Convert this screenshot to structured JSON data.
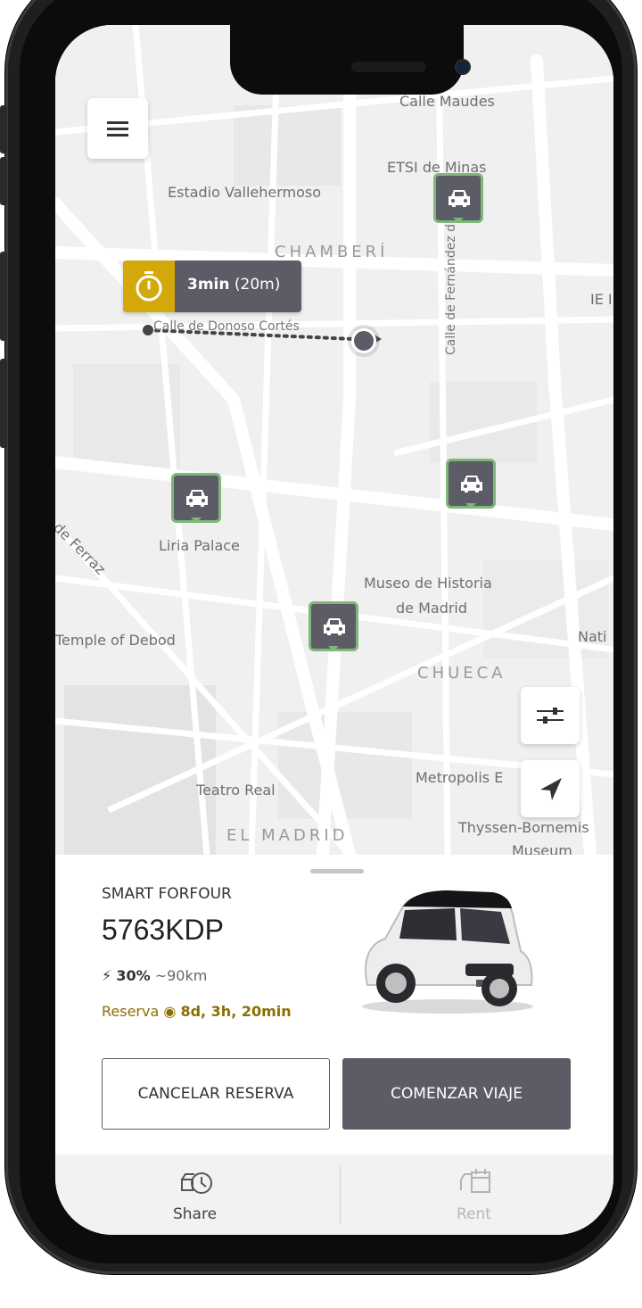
{
  "map": {
    "labels": {
      "calle_maudes": "Calle Maudes",
      "etsi_minas": "ETSI de Minas",
      "estadio": "Estadio Vallehermoso",
      "chamberi": "CHAMBERÍ",
      "fernandez": "Calle de Fernández de la Hoz",
      "ie": "IE I",
      "donoso": "Calle de Donoso Cortés",
      "ferraz": "le de Ferraz",
      "liria": "Liria Palace",
      "museo_line1": "Museo de Historia",
      "museo_line2": "de Madrid",
      "debod": "Temple of Debod",
      "chueca": "CHUECA",
      "nati": "Nati",
      "metropolis": "Metropolis E",
      "teatro": "Teatro Real",
      "el_madrid": "EL MADRID",
      "thyssen": "Thyssen-Bornemis",
      "museum": "Museum"
    },
    "eta": {
      "time": "3min",
      "distance": "(20m)"
    },
    "icons": {
      "menu": "menu-icon",
      "timer": "timer-icon",
      "car": "car-icon",
      "filter": "sliders-icon",
      "locate": "navigation-arrow-icon"
    }
  },
  "vehicle": {
    "model": "SMART FORFOUR",
    "plate": "5763KDP",
    "battery_icon": "bolt-icon",
    "battery_percent": "30%",
    "range": "~90km",
    "reserve_label": "Reserva",
    "reserve_time": "8d, 3h, 20min"
  },
  "actions": {
    "cancel": "CANCELAR RESERVA",
    "start": "COMENZAR VIAJE"
  },
  "tabs": [
    {
      "label": "Share",
      "icon": "car-clock-icon",
      "active": true
    },
    {
      "label": "Rent",
      "icon": "car-calendar-icon",
      "active": false
    }
  ],
  "colors": {
    "accent_yellow": "#d2a80a",
    "pin_green": "#7fb77a",
    "primary_gray": "#5b5c65",
    "reserve_text": "#8b6e00"
  }
}
